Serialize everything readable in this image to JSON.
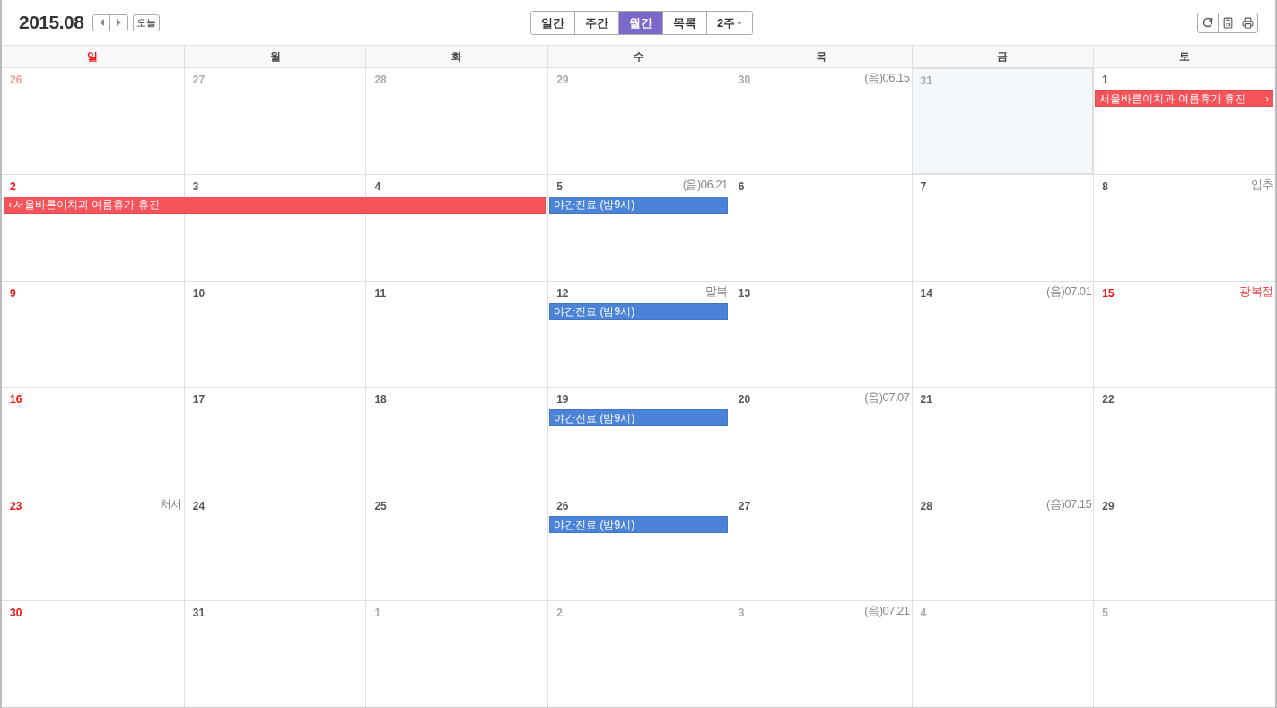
{
  "header": {
    "title": "2015.08",
    "today_button": "오늘",
    "views": [
      {
        "label": "일간",
        "selected": false
      },
      {
        "label": "주간",
        "selected": false
      },
      {
        "label": "월간",
        "selected": true
      },
      {
        "label": "목록",
        "selected": false
      },
      {
        "label": "2주",
        "selected": false,
        "kind": "dropdown"
      }
    ]
  },
  "weekdays": [
    {
      "label": "일",
      "kind": "holiday"
    },
    {
      "label": "월",
      "kind": "normal"
    },
    {
      "label": "화",
      "kind": "normal"
    },
    {
      "label": "수",
      "kind": "normal"
    },
    {
      "label": "목",
      "kind": "normal"
    },
    {
      "label": "금",
      "kind": "normal"
    },
    {
      "label": "토",
      "kind": "normal"
    }
  ],
  "weeks": [
    {
      "days": [
        {
          "date": "26",
          "kind": "holiday",
          "in_month": false,
          "selected": false
        },
        {
          "date": "27",
          "kind": "normal",
          "in_month": false,
          "selected": false
        },
        {
          "date": "28",
          "kind": "normal",
          "in_month": false,
          "selected": false
        },
        {
          "date": "29",
          "kind": "normal",
          "in_month": false,
          "selected": false
        },
        {
          "date": "30",
          "kind": "normal",
          "in_month": false,
          "selected": false,
          "note": {
            "text": "(음)06.15",
            "color": "#888888"
          }
        },
        {
          "date": "31",
          "kind": "normal",
          "in_month": false,
          "selected": true
        },
        {
          "date": "1",
          "kind": "normal",
          "in_month": true,
          "selected": false,
          "events": [
            {
              "kind": "start",
              "title": "서울바른이치과 여름휴가 휴진",
              "color": "#f5525a",
              "suffix": "›"
            }
          ]
        }
      ]
    },
    {
      "days": [
        {
          "date": "2",
          "kind": "holiday",
          "in_month": true,
          "selected": false,
          "events": [
            {
              "kind": "start",
              "title": "서울바른이치과 여름휴가 휴진",
              "color": "#f5525a",
              "prefix": "‹"
            }
          ]
        },
        {
          "date": "3",
          "kind": "normal",
          "in_month": true,
          "selected": false,
          "events": [
            {
              "kind": "continuation"
            }
          ]
        },
        {
          "date": "4",
          "kind": "normal",
          "in_month": true,
          "selected": false,
          "events": [
            {
              "kind": "continuation"
            }
          ]
        },
        {
          "date": "5",
          "kind": "normal",
          "in_month": true,
          "selected": false,
          "note": {
            "text": "(음)06.21",
            "color": "#888888"
          },
          "events": [
            {
              "kind": "start",
              "title": "야간진료 (밤9시)",
              "color": "#4a83d8"
            }
          ]
        },
        {
          "date": "6",
          "kind": "normal",
          "in_month": true,
          "selected": false
        },
        {
          "date": "7",
          "kind": "normal",
          "in_month": true,
          "selected": false
        },
        {
          "date": "8",
          "kind": "normal",
          "in_month": true,
          "selected": false,
          "note": {
            "text": "입추",
            "color": "#888888"
          }
        }
      ]
    },
    {
      "days": [
        {
          "date": "9",
          "kind": "holiday",
          "in_month": true,
          "selected": false
        },
        {
          "date": "10",
          "kind": "normal",
          "in_month": true,
          "selected": false
        },
        {
          "date": "11",
          "kind": "normal",
          "in_month": true,
          "selected": false
        },
        {
          "date": "12",
          "kind": "normal",
          "in_month": true,
          "selected": false,
          "note": {
            "text": "말복",
            "color": "#888888"
          },
          "events": [
            {
              "kind": "start",
              "title": "야간진료 (밤9시)",
              "color": "#4a83d8"
            }
          ]
        },
        {
          "date": "13",
          "kind": "normal",
          "in_month": true,
          "selected": false
        },
        {
          "date": "14",
          "kind": "normal",
          "in_month": true,
          "selected": false,
          "note": {
            "text": "(음)07.01",
            "color": "#888888"
          }
        },
        {
          "date": "15",
          "kind": "holiday",
          "in_month": true,
          "selected": false,
          "note": {
            "text": "광복절",
            "color": "#ee4444"
          }
        }
      ]
    },
    {
      "days": [
        {
          "date": "16",
          "kind": "holiday",
          "in_month": true,
          "selected": false
        },
        {
          "date": "17",
          "kind": "normal",
          "in_month": true,
          "selected": false
        },
        {
          "date": "18",
          "kind": "normal",
          "in_month": true,
          "selected": false
        },
        {
          "date": "19",
          "kind": "normal",
          "in_month": true,
          "selected": false,
          "events": [
            {
              "kind": "start",
              "title": "야간진료 (밤9시)",
              "color": "#4a83d8"
            }
          ]
        },
        {
          "date": "20",
          "kind": "normal",
          "in_month": true,
          "selected": false,
          "note": {
            "text": "(음)07.07",
            "color": "#888888"
          }
        },
        {
          "date": "21",
          "kind": "normal",
          "in_month": true,
          "selected": false
        },
        {
          "date": "22",
          "kind": "normal",
          "in_month": true,
          "selected": false
        }
      ]
    },
    {
      "days": [
        {
          "date": "23",
          "kind": "holiday",
          "in_month": true,
          "selected": false,
          "note": {
            "text": "처서",
            "color": "#888888"
          }
        },
        {
          "date": "24",
          "kind": "normal",
          "in_month": true,
          "selected": false
        },
        {
          "date": "25",
          "kind": "normal",
          "in_month": true,
          "selected": false
        },
        {
          "date": "26",
          "kind": "normal",
          "in_month": true,
          "selected": false,
          "events": [
            {
              "kind": "start",
              "title": "야간진료 (밤9시)",
              "color": "#4a83d8"
            }
          ]
        },
        {
          "date": "27",
          "kind": "normal",
          "in_month": true,
          "selected": false
        },
        {
          "date": "28",
          "kind": "normal",
          "in_month": true,
          "selected": false,
          "note": {
            "text": "(음)07.15",
            "color": "#888888"
          }
        },
        {
          "date": "29",
          "kind": "normal",
          "in_month": true,
          "selected": false
        }
      ]
    },
    {
      "days": [
        {
          "date": "30",
          "kind": "holiday",
          "in_month": true,
          "selected": false
        },
        {
          "date": "31",
          "kind": "normal",
          "in_month": true,
          "selected": false
        },
        {
          "date": "1",
          "kind": "normal",
          "in_month": false,
          "selected": false
        },
        {
          "date": "2",
          "kind": "normal",
          "in_month": false,
          "selected": false
        },
        {
          "date": "3",
          "kind": "normal",
          "in_month": false,
          "selected": false,
          "note": {
            "text": "(음)07.21",
            "color": "#888888"
          }
        },
        {
          "date": "4",
          "kind": "normal",
          "in_month": false,
          "selected": false
        },
        {
          "date": "5",
          "kind": "normal",
          "in_month": false,
          "selected": false
        }
      ]
    }
  ]
}
